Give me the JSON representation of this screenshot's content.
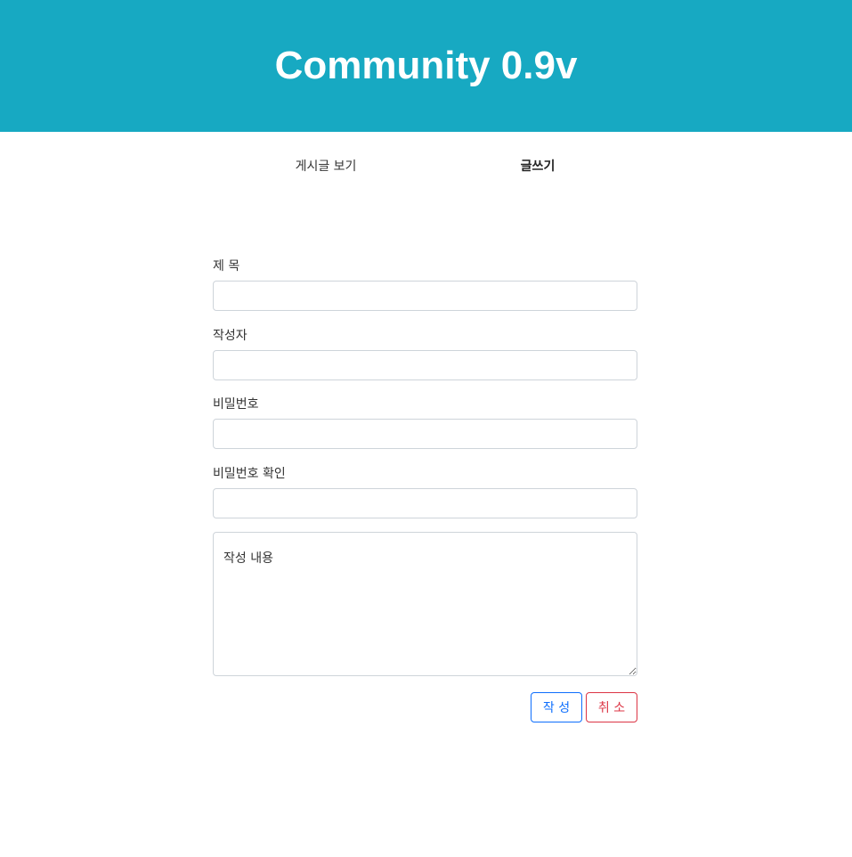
{
  "header": {
    "title": "Community 0.9v",
    "bg_color": "#17a9c2"
  },
  "nav": {
    "items": [
      {
        "label": "게시글 보기",
        "active": false
      },
      {
        "label": "글쓰기",
        "active": true
      }
    ]
  },
  "form": {
    "title_label": "제 목",
    "title_value": "",
    "author_label": "작성자",
    "author_value": "",
    "password_label": "비밀번호",
    "password_value": "",
    "password_confirm_label": "비밀번호 확인",
    "password_confirm_value": "",
    "content_placeholder": "작성 내용",
    "content_value": "",
    "submit_label": "작 성",
    "cancel_label": "취 소"
  }
}
